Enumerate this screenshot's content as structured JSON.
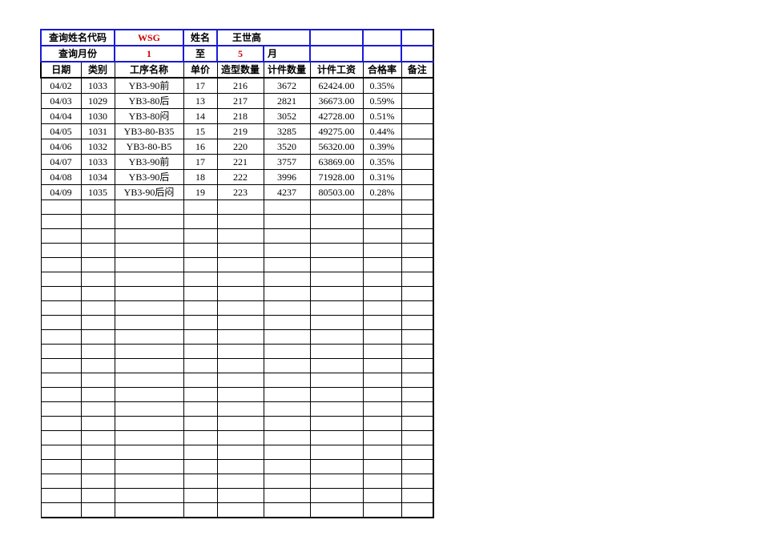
{
  "header": {
    "row1": {
      "label_name_code": "查询姓名代码",
      "name_code": "WSG",
      "label_name": "姓名",
      "name": "王世高"
    },
    "row2": {
      "label_month": "查询月份",
      "month_from": "1",
      "label_to": "至",
      "month_to": "5",
      "label_unit": "月"
    }
  },
  "columns": [
    "日期",
    "类别",
    "工序名称",
    "单价",
    "造型数量",
    "计件数量",
    "计件工资",
    "合格率",
    "备注"
  ],
  "rows": [
    {
      "date": "04/02",
      "cat": "1033",
      "proc": "YB3-90前",
      "price": "17",
      "mold": "216",
      "pcs": "3672",
      "wage": "62424.00",
      "rate": "0.35%",
      "note": ""
    },
    {
      "date": "04/03",
      "cat": "1029",
      "proc": "YB3-80后",
      "price": "13",
      "mold": "217",
      "pcs": "2821",
      "wage": "36673.00",
      "rate": "0.59%",
      "note": ""
    },
    {
      "date": "04/04",
      "cat": "1030",
      "proc": "YB3-80闷",
      "price": "14",
      "mold": "218",
      "pcs": "3052",
      "wage": "42728.00",
      "rate": "0.51%",
      "note": ""
    },
    {
      "date": "04/05",
      "cat": "1031",
      "proc": "YB3-80-B35",
      "price": "15",
      "mold": "219",
      "pcs": "3285",
      "wage": "49275.00",
      "rate": "0.44%",
      "note": ""
    },
    {
      "date": "04/06",
      "cat": "1032",
      "proc": "YB3-80-B5",
      "price": "16",
      "mold": "220",
      "pcs": "3520",
      "wage": "56320.00",
      "rate": "0.39%",
      "note": ""
    },
    {
      "date": "04/07",
      "cat": "1033",
      "proc": "YB3-90前",
      "price": "17",
      "mold": "221",
      "pcs": "3757",
      "wage": "63869.00",
      "rate": "0.35%",
      "note": ""
    },
    {
      "date": "04/08",
      "cat": "1034",
      "proc": "YB3-90后",
      "price": "18",
      "mold": "222",
      "pcs": "3996",
      "wage": "71928.00",
      "rate": "0.31%",
      "note": ""
    },
    {
      "date": "04/09",
      "cat": "1035",
      "proc": "YB3-90后闷",
      "price": "19",
      "mold": "223",
      "pcs": "4237",
      "wage": "80503.00",
      "rate": "0.28%",
      "note": ""
    }
  ],
  "empty_rows_count": 22
}
